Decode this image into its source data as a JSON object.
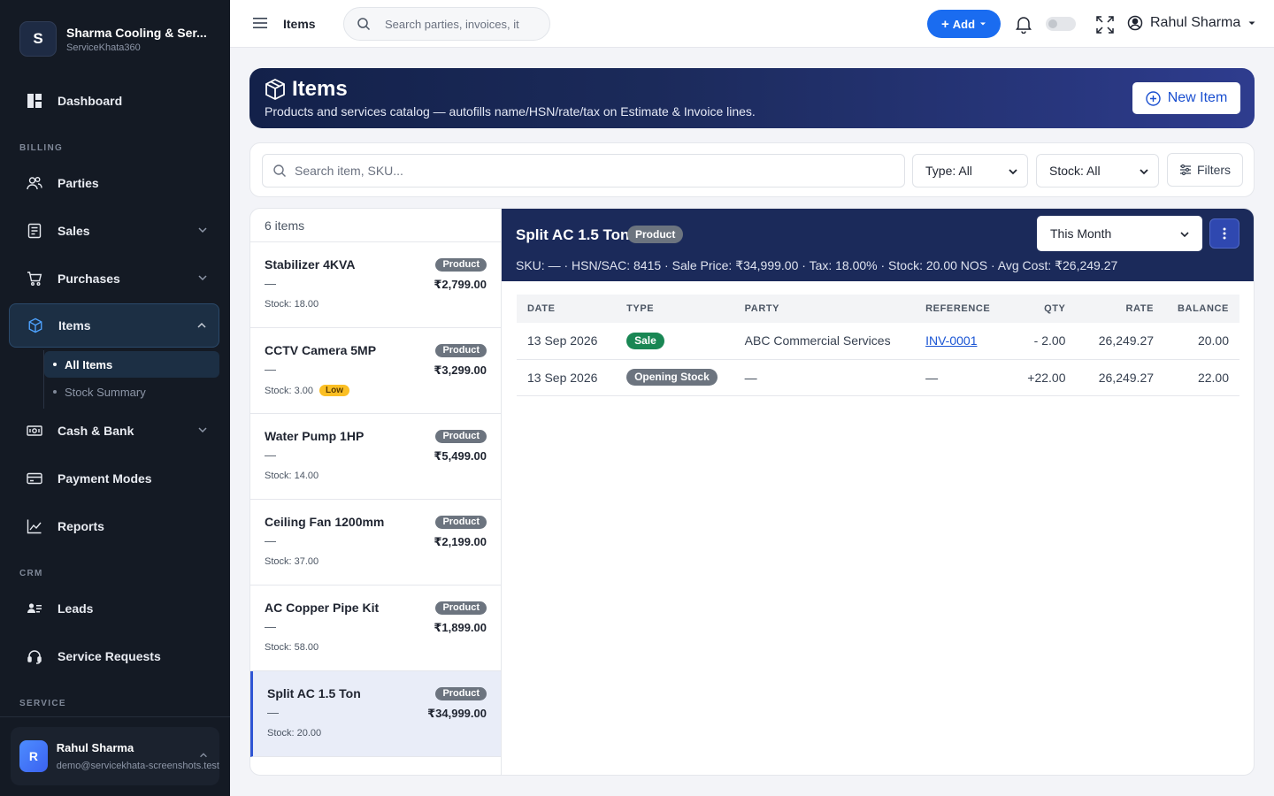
{
  "brand": {
    "initial": "S",
    "name": "Sharma Cooling & Ser...",
    "subtitle": "ServiceKhata360"
  },
  "sidebar": {
    "sections": {
      "billing": "BILLING",
      "crm": "CRM",
      "service": "SERVICE"
    },
    "items": {
      "dashboard": "Dashboard",
      "parties": "Parties",
      "sales": "Sales",
      "purchases": "Purchases",
      "items": "Items",
      "cash_bank": "Cash & Bank",
      "payment_modes": "Payment Modes",
      "reports": "Reports",
      "leads": "Leads",
      "service_requests": "Service Requests"
    },
    "items_sub": {
      "all_items": "All Items",
      "stock_summary": "Stock Summary"
    },
    "user": {
      "initial": "R",
      "name": "Rahul Sharma",
      "email": "demo@servicekhata-screenshots.test"
    }
  },
  "topbar": {
    "title": "Items",
    "search_placeholder": "Search parties, invoices, it",
    "add_label": "Add",
    "user_name": "Rahul Sharma"
  },
  "hero": {
    "title": "Items",
    "subtitle": "Products and services catalog — autofills name/HSN/rate/tax on Estimate & Invoice lines.",
    "new_item_label": "New Item"
  },
  "filters": {
    "search_placeholder": "Search item, SKU...",
    "type_value": "Type: All",
    "stock_value": "Stock: All",
    "filters_label": "Filters"
  },
  "list": {
    "count_label": "6 items",
    "items": [
      {
        "name": "Stabilizer 4KVA",
        "badge": "Product",
        "dash": "—",
        "price": "₹2,799.00",
        "stock": "Stock: 18.00",
        "low": ""
      },
      {
        "name": "CCTV Camera 5MP",
        "badge": "Product",
        "dash": "—",
        "price": "₹3,299.00",
        "stock": "Stock: 3.00",
        "low": "Low"
      },
      {
        "name": "Water Pump 1HP",
        "badge": "Product",
        "dash": "—",
        "price": "₹5,499.00",
        "stock": "Stock: 14.00",
        "low": ""
      },
      {
        "name": "Ceiling Fan 1200mm",
        "badge": "Product",
        "dash": "—",
        "price": "₹2,199.00",
        "stock": "Stock: 37.00",
        "low": ""
      },
      {
        "name": "AC Copper Pipe Kit",
        "badge": "Product",
        "dash": "—",
        "price": "₹1,899.00",
        "stock": "Stock: 58.00",
        "low": ""
      },
      {
        "name": "Split AC 1.5 Ton",
        "badge": "Product",
        "dash": "—",
        "price": "₹34,999.00",
        "stock": "Stock: 20.00",
        "low": ""
      }
    ]
  },
  "detail": {
    "title": "Split AC 1.5 Ton",
    "badge": "Product",
    "meta": "SKU: — · HSN/SAC: 8415 · Sale Price: ₹34,999.00 · Tax: 18.00% · Stock: 20.00 NOS · Avg Cost: ₹26,249.27",
    "period": "This Month",
    "columns": [
      "DATE",
      "TYPE",
      "PARTY",
      "REFERENCE",
      "QTY",
      "RATE",
      "BALANCE"
    ],
    "rows": [
      {
        "date": "13 Sep 2026",
        "type": "Sale",
        "party": "ABC Commercial Services",
        "reference": "INV-0001",
        "qty": "- 2.00",
        "rate": "26,249.27",
        "balance": "20.00"
      },
      {
        "date": "13 Sep 2026",
        "type": "Opening Stock",
        "party": "—",
        "reference": "—",
        "qty": "+22.00",
        "rate": "26,249.27",
        "balance": "22.00"
      }
    ]
  },
  "colors": {
    "sidebar_bg": "#141a24",
    "accent_blue": "#1a6cf0",
    "hero_dark": "#1b2a5a",
    "sale_green": "#198754",
    "negative_red": "#d9334a",
    "low_yellow": "#fbbf24"
  },
  "icons": {
    "dashboard": "dashboard-icon",
    "parties": "users-icon",
    "sales": "receipt-icon",
    "purchases": "cart-icon",
    "items": "box-icon",
    "cash_bank": "cash-icon",
    "payment_modes": "card-icon",
    "reports": "chart-line-icon",
    "leads": "address-card-icon",
    "service_requests": "headset-icon"
  }
}
